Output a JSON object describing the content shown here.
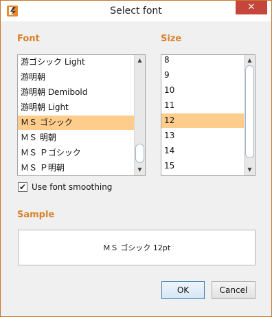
{
  "window": {
    "title": "Select font",
    "close_glyph": "✕",
    "accent": "#d9822b",
    "close_color": "#c7463b"
  },
  "font_section": {
    "label": "Font",
    "items": [
      "游ゴシック Light",
      "游明朝",
      "游明朝 Demibold",
      "游明朝 Light",
      "ＭＳ ゴシック",
      "ＭＳ 明朝",
      "ＭＳ Ｐゴシック",
      "ＭＳ Ｐ明朝"
    ],
    "selected": "ＭＳ ゴシック"
  },
  "size_section": {
    "label": "Size",
    "items": [
      "8",
      "9",
      "10",
      "11",
      "12",
      "13",
      "14",
      "15"
    ],
    "selected": "12"
  },
  "smoothing": {
    "label": "Use font smoothing",
    "checked": true
  },
  "sample": {
    "label": "Sample",
    "text": "ＭＳ ゴシック 12pt"
  },
  "buttons": {
    "ok": "OK",
    "cancel": "Cancel"
  },
  "selection_color": "#fecd8c"
}
